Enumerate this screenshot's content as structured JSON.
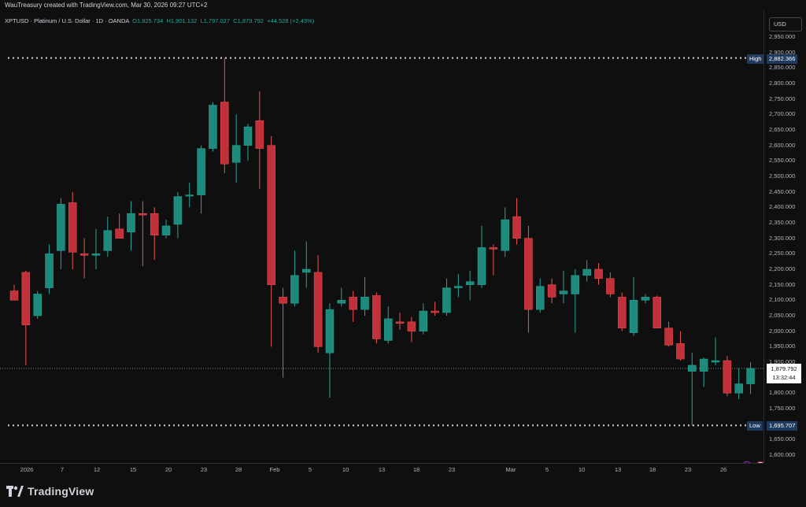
{
  "header": {
    "created_by": "WauTreasury created with TradingView.com, Mar 30, 2026 09:27 UTC+2"
  },
  "legend": {
    "symbol": "XPTUSD · Platinum / U.S. Dollar · 1D · OANDA",
    "open": "O1,825.734",
    "high": "H1,901.132",
    "low": "L1,797.027",
    "close": "C1,879.792",
    "change": "+44.528 (+2.43%)"
  },
  "price_axis": {
    "currency_button": "USD",
    "high_tag": "High",
    "high_value": "2,882.366",
    "low_tag": "Low",
    "low_value": "1,695.707",
    "last_price": "1,879.792",
    "countdown": "13:32:44"
  },
  "footer": {
    "brand": "TradingView"
  },
  "colors": {
    "up": "#26a69a",
    "down": "#ef5350",
    "down_body": "#b2323b",
    "up_body": "#1f7a70",
    "background": "#0f0f0f",
    "high_tag_bg": "#1e3a5f"
  },
  "icons": [
    "lightning-icon",
    "flag-icon"
  ],
  "chart_data": {
    "type": "candlestick",
    "ylim": [
      1600,
      3000
    ],
    "yticks": [
      "1,600.000",
      "1,650.000",
      "1,700.000",
      "1,750.000",
      "1,800.000",
      "1,850.000",
      "1,900.000",
      "1,950.000",
      "2,000.000",
      "2,050.000",
      "2,100.000",
      "2,150.000",
      "2,200.000",
      "2,250.000",
      "2,300.000",
      "2,350.000",
      "2,400.000",
      "2,450.000",
      "2,500.000",
      "2,550.000",
      "2,600.000",
      "2,650.000",
      "2,700.000",
      "2,750.000",
      "2,800.000",
      "2,850.000",
      "2,900.000",
      "2,950.000"
    ],
    "xticks": [
      "2026",
      "7",
      "12",
      "15",
      "20",
      "23",
      "28",
      "Feb",
      "5",
      "10",
      "13",
      "18",
      "23",
      "Mar",
      "5",
      "10",
      "13",
      "18",
      "23",
      "26"
    ],
    "candles": [
      {
        "o": 2130,
        "h": 2150,
        "l": 2100,
        "c": 2100
      },
      {
        "o": 2190,
        "h": 2195,
        "l": 1890,
        "c": 2020
      },
      {
        "o": 2050,
        "h": 2130,
        "l": 2040,
        "c": 2120
      },
      {
        "o": 2140,
        "h": 2280,
        "l": 2120,
        "c": 2250
      },
      {
        "o": 2260,
        "h": 2430,
        "l": 2200,
        "c": 2410
      },
      {
        "o": 2415,
        "h": 2450,
        "l": 2200,
        "c": 2255
      },
      {
        "o": 2250,
        "h": 2300,
        "l": 2170,
        "c": 2245
      },
      {
        "o": 2245,
        "h": 2330,
        "l": 2200,
        "c": 2250
      },
      {
        "o": 2260,
        "h": 2370,
        "l": 2240,
        "c": 2325
      },
      {
        "o": 2330,
        "h": 2380,
        "l": 2300,
        "c": 2300
      },
      {
        "o": 2320,
        "h": 2420,
        "l": 2260,
        "c": 2380
      },
      {
        "o": 2380,
        "h": 2420,
        "l": 2210,
        "c": 2375
      },
      {
        "o": 2380,
        "h": 2400,
        "l": 2230,
        "c": 2310
      },
      {
        "o": 2310,
        "h": 2360,
        "l": 2300,
        "c": 2340
      },
      {
        "o": 2345,
        "h": 2450,
        "l": 2300,
        "c": 2435
      },
      {
        "o": 2440,
        "h": 2480,
        "l": 2400,
        "c": 2440
      },
      {
        "o": 2440,
        "h": 2600,
        "l": 2380,
        "c": 2590
      },
      {
        "o": 2590,
        "h": 2740,
        "l": 2580,
        "c": 2730
      },
      {
        "o": 2740,
        "h": 2882,
        "l": 2510,
        "c": 2540
      },
      {
        "o": 2545,
        "h": 2700,
        "l": 2480,
        "c": 2600
      },
      {
        "o": 2600,
        "h": 2670,
        "l": 2550,
        "c": 2660
      },
      {
        "o": 2680,
        "h": 2775,
        "l": 2460,
        "c": 2590
      },
      {
        "o": 2600,
        "h": 2630,
        "l": 1950,
        "c": 2150
      },
      {
        "o": 2110,
        "h": 2140,
        "l": 1850,
        "c": 2090
      },
      {
        "o": 2090,
        "h": 2260,
        "l": 2080,
        "c": 2180
      },
      {
        "o": 2190,
        "h": 2290,
        "l": 2140,
        "c": 2200
      },
      {
        "o": 2190,
        "h": 2245,
        "l": 1930,
        "c": 1950
      },
      {
        "o": 1930,
        "h": 2090,
        "l": 1785,
        "c": 2070
      },
      {
        "o": 2090,
        "h": 2140,
        "l": 2080,
        "c": 2100
      },
      {
        "o": 2110,
        "h": 2130,
        "l": 2030,
        "c": 2070
      },
      {
        "o": 2070,
        "h": 2175,
        "l": 2050,
        "c": 2110
      },
      {
        "o": 2115,
        "h": 2125,
        "l": 1960,
        "c": 1975
      },
      {
        "o": 1970,
        "h": 2080,
        "l": 1960,
        "c": 2040
      },
      {
        "o": 2030,
        "h": 2060,
        "l": 2005,
        "c": 2025
      },
      {
        "o": 2030,
        "h": 2045,
        "l": 1965,
        "c": 2000
      },
      {
        "o": 2000,
        "h": 2090,
        "l": 1990,
        "c": 2065
      },
      {
        "o": 2065,
        "h": 2095,
        "l": 2050,
        "c": 2060
      },
      {
        "o": 2060,
        "h": 2170,
        "l": 2050,
        "c": 2140
      },
      {
        "o": 2140,
        "h": 2185,
        "l": 2110,
        "c": 2145
      },
      {
        "o": 2150,
        "h": 2195,
        "l": 2100,
        "c": 2160
      },
      {
        "o": 2150,
        "h": 2340,
        "l": 2140,
        "c": 2270
      },
      {
        "o": 2270,
        "h": 2280,
        "l": 2180,
        "c": 2265
      },
      {
        "o": 2260,
        "h": 2400,
        "l": 2240,
        "c": 2360
      },
      {
        "o": 2370,
        "h": 2430,
        "l": 2280,
        "c": 2300
      },
      {
        "o": 2300,
        "h": 2340,
        "l": 1995,
        "c": 2070
      },
      {
        "o": 2070,
        "h": 2170,
        "l": 2060,
        "c": 2145
      },
      {
        "o": 2150,
        "h": 2170,
        "l": 2090,
        "c": 2110
      },
      {
        "o": 2120,
        "h": 2195,
        "l": 2090,
        "c": 2130
      },
      {
        "o": 2120,
        "h": 2200,
        "l": 1995,
        "c": 2180
      },
      {
        "o": 2180,
        "h": 2230,
        "l": 2160,
        "c": 2200
      },
      {
        "o": 2200,
        "h": 2220,
        "l": 2150,
        "c": 2170
      },
      {
        "o": 2170,
        "h": 2190,
        "l": 2110,
        "c": 2120
      },
      {
        "o": 2110,
        "h": 2125,
        "l": 2000,
        "c": 2010
      },
      {
        "o": 1995,
        "h": 2175,
        "l": 1985,
        "c": 2100
      },
      {
        "o": 2100,
        "h": 2120,
        "l": 2090,
        "c": 2110
      },
      {
        "o": 2110,
        "h": 2115,
        "l": 2010,
        "c": 2010
      },
      {
        "o": 2010,
        "h": 2030,
        "l": 1950,
        "c": 1955
      },
      {
        "o": 1960,
        "h": 2000,
        "l": 1905,
        "c": 1910
      },
      {
        "o": 1870,
        "h": 1930,
        "l": 1695,
        "c": 1890
      },
      {
        "o": 1870,
        "h": 1915,
        "l": 1820,
        "c": 1910
      },
      {
        "o": 1900,
        "h": 1980,
        "l": 1890,
        "c": 1905
      },
      {
        "o": 1905,
        "h": 1920,
        "l": 1790,
        "c": 1800
      },
      {
        "o": 1800,
        "h": 1880,
        "l": 1780,
        "c": 1830
      },
      {
        "o": 1830,
        "h": 1900,
        "l": 1797,
        "c": 1880
      }
    ]
  }
}
